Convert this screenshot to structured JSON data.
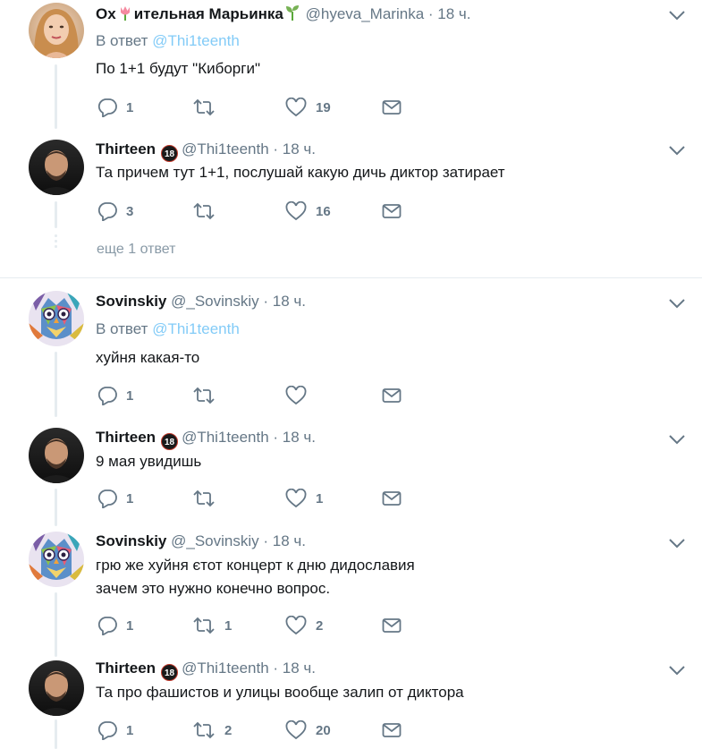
{
  "tweets": [
    {
      "name": "Ох",
      "name_suffix": "ительная Марьинка",
      "handle": "@hyeva_Marinka",
      "time": "18 ч.",
      "reply_prefix": "В ответ",
      "reply_to": "@Thi1teenth",
      "lines": [
        "По 1+1 будут \"Киборги\""
      ],
      "replies": "1",
      "retweets": "",
      "likes": "19",
      "avatar_icon": "woman-avatar",
      "emoji_icons": [
        "tulip-icon",
        "seedling-icon"
      ]
    },
    {
      "name": "Thirteen",
      "badge": "18",
      "handle": "@Thi1teenth",
      "time": "18 ч.",
      "lines": [
        "Та причем тут 1+1, послушай какую дичь диктор затирает"
      ],
      "replies": "3",
      "retweets": "",
      "likes": "16",
      "avatar_icon": "man-avatar"
    },
    {
      "name": "Sovinskiy",
      "handle": "@_Sovinskiy",
      "time": "18 ч.",
      "reply_prefix": "В ответ",
      "reply_to": "@Thi1teenth",
      "lines": [
        "хуйня какая-то"
      ],
      "replies": "1",
      "retweets": "",
      "likes": "",
      "avatar_icon": "owl-avatar"
    },
    {
      "name": "Thirteen",
      "badge": "18",
      "handle": "@Thi1teenth",
      "time": "18 ч.",
      "lines": [
        "9 мая увидишь"
      ],
      "replies": "1",
      "retweets": "",
      "likes": "1",
      "avatar_icon": "man-avatar"
    },
    {
      "name": "Sovinskiy",
      "handle": "@_Sovinskiy",
      "time": "18 ч.",
      "lines": [
        "грю же хуйня єтот концерт к дню дидославия",
        "зачем это нужно конечно вопрос."
      ],
      "replies": "1",
      "retweets": "1",
      "likes": "2",
      "avatar_icon": "owl-avatar"
    },
    {
      "name": "Thirteen",
      "badge": "18",
      "handle": "@Thi1teenth",
      "time": "18 ч.",
      "lines": [
        "Та про фашистов и улицы вообще залип от диктора"
      ],
      "replies": "1",
      "retweets": "2",
      "likes": "20",
      "avatar_icon": "man-avatar"
    }
  ],
  "more_replies": "еще 1 ответ",
  "colors": {
    "text": "#14171a",
    "muted": "#657786",
    "link": "#1da1f2",
    "line": "#e6ecf0"
  }
}
